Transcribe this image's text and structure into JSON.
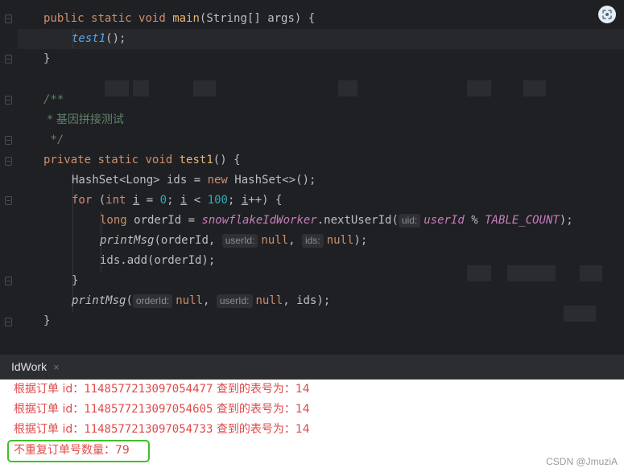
{
  "editor": {
    "lines": {
      "main_sig": {
        "kw1": "public",
        "kw2": "static",
        "kw3": "void",
        "name": "main",
        "params": "(String[] args) {"
      },
      "call_test1": {
        "name": "test1",
        "rest": "();"
      },
      "close1": "}",
      "javadoc_open": "/**",
      "javadoc_text": " * 基因拼接测试",
      "javadoc_close": " */",
      "test1_sig": {
        "kw1": "private",
        "kw2": "static",
        "kw3": "void",
        "name": "test1",
        "params": "() {"
      },
      "hashset": {
        "type": "HashSet<Long> ids = ",
        "kw": "new",
        "rest": " HashSet<>();"
      },
      "for_loop": {
        "kw": "for",
        "p1": " (",
        "kw_int": "int",
        "var": "i",
        "eq": " = ",
        "zero": "0",
        "semi": "; ",
        "var2": "i",
        "lt": " < ",
        "hundred": "100",
        "semi2": "; ",
        "var3": "i",
        "rest": "++) {"
      },
      "long_line": {
        "kw": "long",
        "decl": " orderId = ",
        "field": "snowflakeIdWorker",
        "method": ".nextUserId(",
        "hint": "uid:",
        "arg": "userId",
        "op": " % ",
        "const": "TABLE_COUNT",
        "end": ");"
      },
      "printmsg1": {
        "name": "printMsg",
        "open": "(orderId, ",
        "hint1": "userId:",
        "kw_null1": "null",
        "comma": ", ",
        "hint2": "ids:",
        "kw_null2": "null",
        "end": ");"
      },
      "add_line": "ids.add(orderId);",
      "close_for": "}",
      "printmsg2": {
        "name": "printMsg",
        "open": "(",
        "hint1": "orderId:",
        "kw_null1": "null",
        "comma1": ", ",
        "hint2": "userId:",
        "kw_null2": "null",
        "rest": ", ids);"
      },
      "close_method": "}"
    }
  },
  "run_panel": {
    "tab_label": "IdWork",
    "tab_close": "×",
    "output": [
      {
        "prefix": "根据订单 id：",
        "number": "1148577213097054477",
        "suffix": " 查到的表号为：14"
      },
      {
        "prefix": "根据订单 id：",
        "number": "1148577213097054605",
        "suffix": " 查到的表号为：14"
      },
      {
        "prefix": "根据订单 id：",
        "number": "1148577213097054733",
        "suffix": " 查到的表号为：14"
      }
    ],
    "summary": "不重复订单号数量：79"
  },
  "watermark": "CSDN @JmuziA",
  "colors": {
    "editor_bg": "#1f2023",
    "keyword": "#cf8e6d",
    "method": "#56a8f5",
    "number": "#2aacb8",
    "output_text": "#e04a4a",
    "highlight_box": "#3fbf2a"
  },
  "icons": {
    "lens": "google-lens-icon",
    "fold": "fold-marker-icon"
  }
}
